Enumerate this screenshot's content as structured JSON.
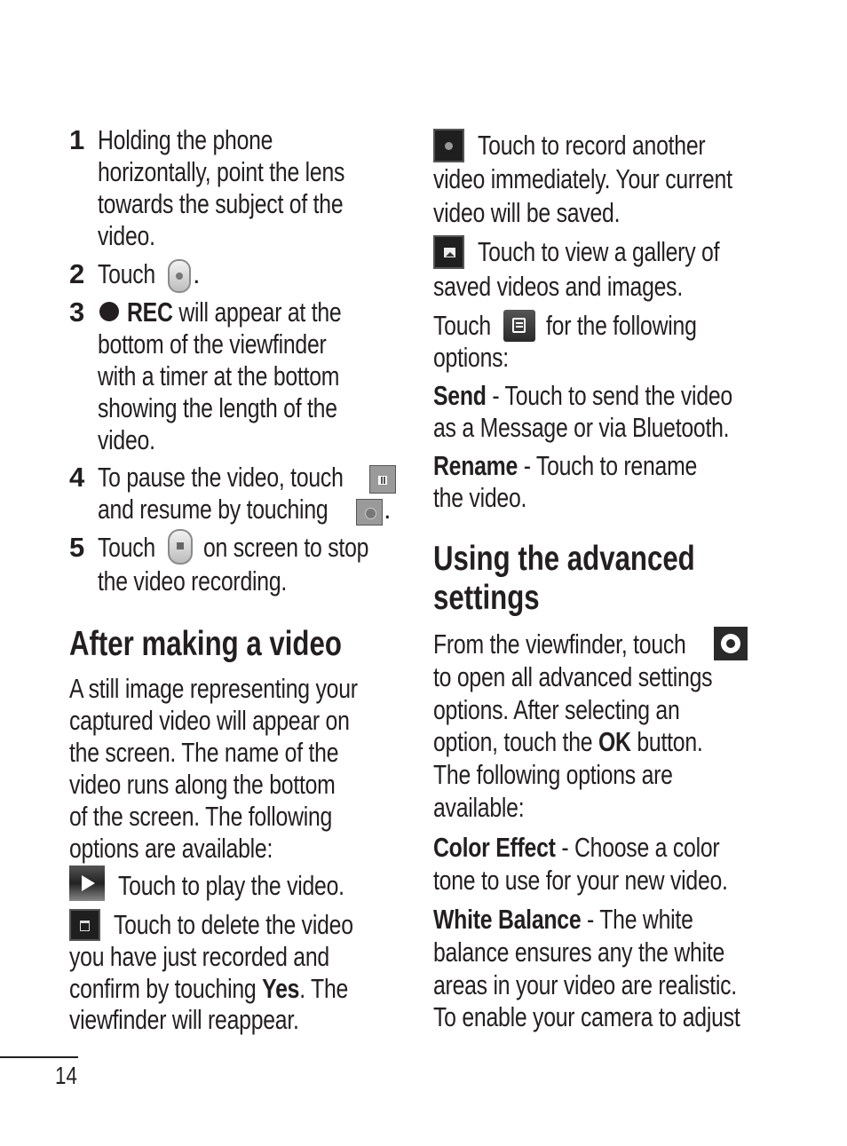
{
  "page_number": "14",
  "left_column": {
    "steps": [
      {
        "number": "1",
        "lines": [
          "Holding the phone",
          "horizontally, point the lens",
          "towards the subject of the",
          "video."
        ]
      },
      {
        "number": "2",
        "lines": [
          "Touch",
          "."
        ]
      },
      {
        "number": "3",
        "rec_label": "REC",
        "lines": [
          "will appear at the",
          "bottom of the viewfinder",
          "with a timer at the bottom",
          "showing the length of the",
          "video."
        ]
      },
      {
        "number": "4",
        "lines": [
          "To pause the video, touch",
          "and resume by touching",
          "."
        ]
      },
      {
        "number": "5",
        "lines": [
          "Touch",
          "on screen to stop",
          "the video recording."
        ]
      }
    ],
    "section_title": "After making a video",
    "intro_lines": [
      "A still image representing your",
      "captured video will appear on",
      "the screen. The name of the",
      "video runs along the bottom",
      "of the screen. The following",
      "options are available:"
    ],
    "play_text": "Touch to play the video.",
    "delete_lines": [
      "Touch to delete the video",
      "you have just recorded and",
      "confirm by touching",
      "Yes",
      ". The",
      "viewfinder will reappear."
    ]
  },
  "right_column": {
    "record_lines": [
      "Touch to record another",
      "video immediately. Your current",
      "video will be saved."
    ],
    "gallery_lines": [
      "Touch to view a gallery of",
      "saved videos and images."
    ],
    "menu_lines": [
      "Touch",
      "for the following",
      "options:"
    ],
    "send": {
      "term": "Send",
      "lines": [
        " - Touch to send the video",
        "as a Message or via Bluetooth."
      ]
    },
    "rename": {
      "term": "Rename",
      "lines": [
        " - Touch to rename",
        "the video."
      ]
    },
    "section_title_lines": [
      "Using the advanced",
      "settings"
    ],
    "settings_lines": [
      "From the viewfinder, touch",
      "to open all advanced settings",
      "options. After selecting an",
      "option, touch the",
      "OK",
      "button.",
      "The following options are",
      "available:"
    ],
    "color_effect": {
      "term": "Color Effect",
      "lines": [
        " - Choose a color",
        "tone to use for your new video."
      ]
    },
    "white_balance": {
      "term": "White Balance",
      "lines": [
        " - The white",
        "balance ensures any the white",
        "areas in your video are realistic.",
        "To enable your camera to adjust"
      ]
    }
  },
  "icons": {
    "capture": "record-button-icon",
    "rec_dot": "rec-dot-icon",
    "pause": "pause-icon",
    "resume": "resume-icon",
    "stop": "stop-button-icon",
    "play": "play-icon",
    "delete": "trash-icon",
    "record_again": "record-icon",
    "gallery": "gallery-icon",
    "menu": "menu-icon",
    "settings": "gear-icon"
  }
}
